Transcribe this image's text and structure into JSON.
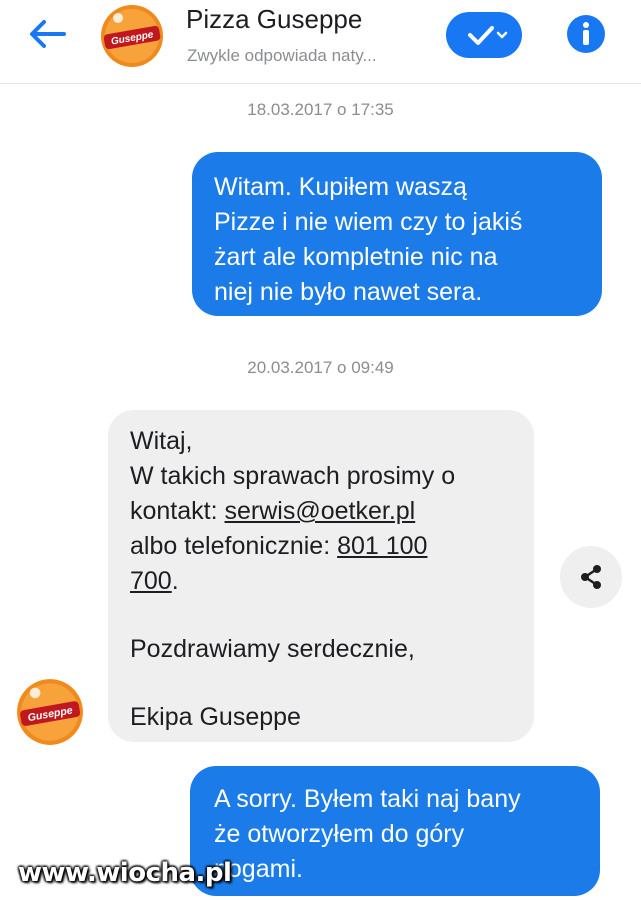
{
  "header": {
    "contact_name": "Pizza Guseppe",
    "status": "Zwykle odpowiada naty...",
    "logo_text": "Guseppe"
  },
  "colors": {
    "accent": "#1877f2",
    "outgoing_bubble": "#1b7be8",
    "incoming_bubble": "#efefef"
  },
  "icons": {
    "back": "arrow-left-icon",
    "verify": "check-chevron-icon",
    "info": "info-icon",
    "share": "share-icon"
  },
  "conversation": {
    "timestamp_1": "18.03.2017 o 17:35",
    "message_1": {
      "lines": [
        "Witam. Kupiłem waszą",
        "Pizze i nie wiem czy to jakiś",
        "żart ale kompletnie nic na",
        "niej nie było nawet sera."
      ]
    },
    "timestamp_2": "20.03.2017 o 09:49",
    "message_2": {
      "line1": "Witaj,",
      "line2": "W takich sprawach prosimy o",
      "line3_prefix": "kontakt: ",
      "email": "serwis@oetker.pl",
      "line4_prefix": "albo telefonicznie: ",
      "phone_part1": "801 100",
      "phone_part2": "700",
      "phone_suffix": ".",
      "greeting": "Pozdrawiamy serdecznie,",
      "signature": "Ekipa Guseppe"
    },
    "message_3": {
      "lines": [
        "A sorry. Byłem taki naj  bany",
        "że otworzyłem do góry",
        "nogami."
      ]
    }
  },
  "watermark": "www.wiocha.pl"
}
